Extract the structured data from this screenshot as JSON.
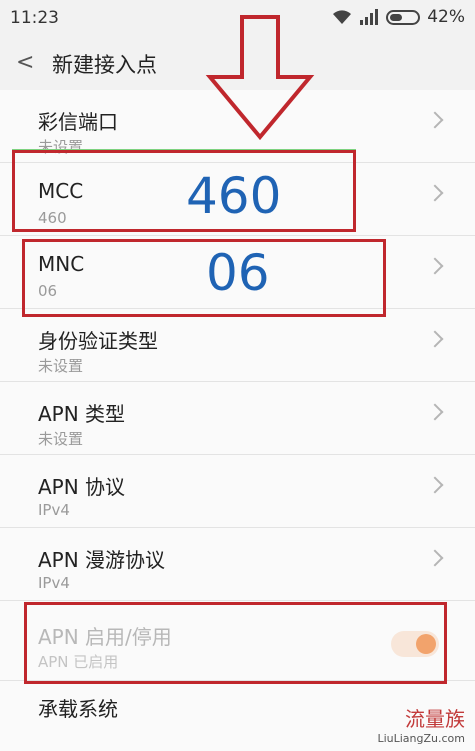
{
  "status_bar": {
    "time": "11:23",
    "battery_text": "42%"
  },
  "header": {
    "title": "新建接入点"
  },
  "items": [
    {
      "label": "彩信端口",
      "value": "未设置"
    },
    {
      "label": "MCC",
      "value": "460"
    },
    {
      "label": "MNC",
      "value": "06"
    },
    {
      "label": "身份验证类型",
      "value": "未设置"
    },
    {
      "label": "APN 类型",
      "value": "未设置"
    },
    {
      "label": "APN 协议",
      "value": "IPv4"
    },
    {
      "label": "APN 漫游协议",
      "value": "IPv4"
    },
    {
      "label": "APN 启用/停用",
      "value": "APN 已启用",
      "toggle_on": true
    },
    {
      "label": "承载系统",
      "value": ""
    }
  ],
  "annotations": {
    "mcc_large": "460",
    "mnc_large": "06"
  },
  "watermark": {
    "title": "流量族",
    "url": "LiuLiangZu.com"
  },
  "colors": {
    "annotation_red": "#c0272d",
    "annotation_blue": "#1f63b4",
    "toggle_orange": "#f2a36c"
  }
}
